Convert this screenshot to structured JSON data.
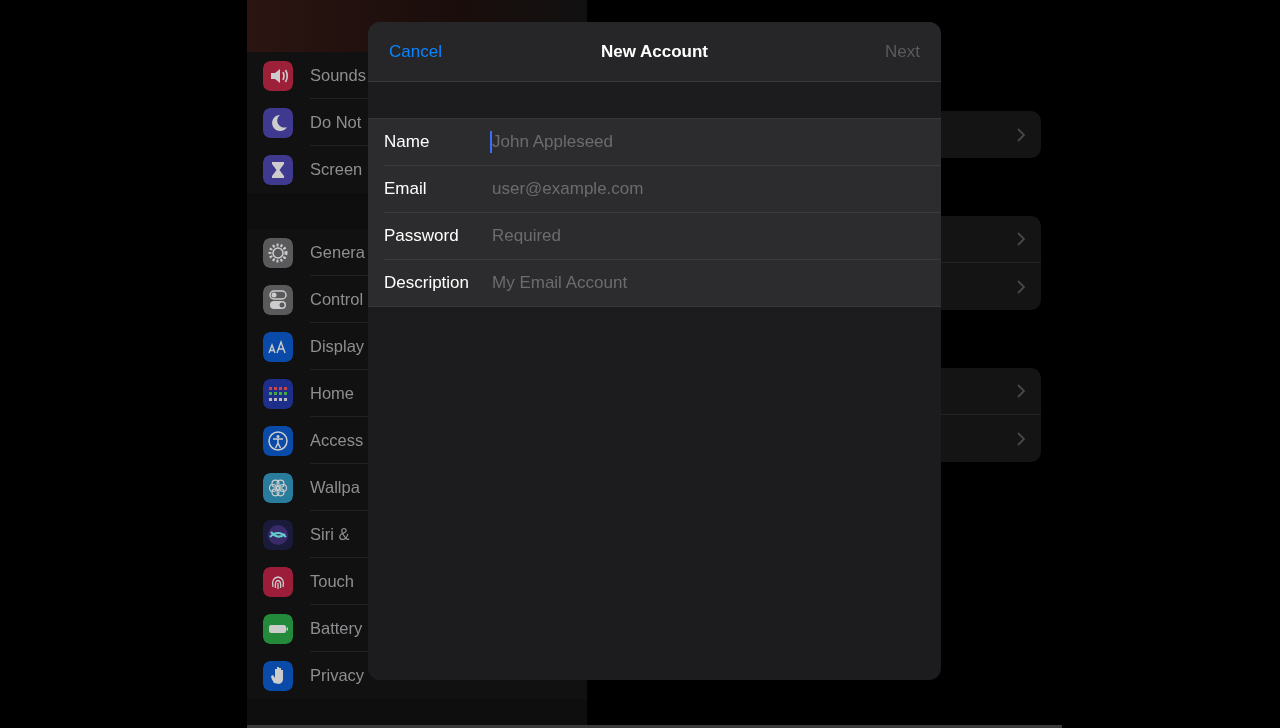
{
  "sidebar": {
    "groups": [
      {
        "items": [
          {
            "label": "Sounds",
            "kind": "speaker",
            "color": "#9c2038"
          },
          {
            "label": "Do Not",
            "kind": "moon",
            "color": "#3f3a8f"
          },
          {
            "label": "Screen",
            "kind": "hourglass",
            "color": "#3f3a8f"
          }
        ]
      },
      {
        "items": [
          {
            "label": "Genera",
            "kind": "gear",
            "color": "#5a5a5c"
          },
          {
            "label": "Control",
            "kind": "toggles",
            "color": "#5a5a5c"
          },
          {
            "label": "Display",
            "kind": "letters",
            "color": "#0a4aa8"
          },
          {
            "label": "Home",
            "kind": "grid",
            "color": "#1d2f8a"
          },
          {
            "label": "Access",
            "kind": "person",
            "color": "#0a4aa8"
          },
          {
            "label": "Wallpa",
            "kind": "flower",
            "color": "#2a7c9c"
          },
          {
            "label": "Siri &",
            "kind": "orb",
            "color": "#1a1a3a"
          },
          {
            "label": "Touch",
            "kind": "fingerprint",
            "color": "#9c1d3a"
          },
          {
            "label": "Battery",
            "kind": "battery",
            "color": "#228a3a"
          },
          {
            "label": "Privacy",
            "kind": "hand",
            "color": "#0a4aa8"
          }
        ]
      }
    ]
  },
  "detail": {
    "groups": [
      {
        "rows": [
          {
            "kind": "chevron"
          }
        ]
      },
      {
        "rows": [
          {
            "kind": "chevron"
          },
          {
            "kind": "chevron"
          }
        ]
      },
      {
        "rows": [
          {
            "kind": "chevron"
          },
          {
            "kind": "chevron"
          }
        ]
      }
    ]
  },
  "sheet": {
    "cancel": "Cancel",
    "title": "New Account",
    "next": {
      "label": "Next",
      "disabled": true
    },
    "fields": [
      {
        "label": "Name",
        "placeholder": "John Appleseed",
        "focused": true
      },
      {
        "label": "Email",
        "placeholder": "user@example.com",
        "focused": false
      },
      {
        "label": "Password",
        "placeholder": "Required",
        "focused": false
      },
      {
        "label": "Description",
        "placeholder": "My Email Account",
        "focused": false
      }
    ]
  }
}
